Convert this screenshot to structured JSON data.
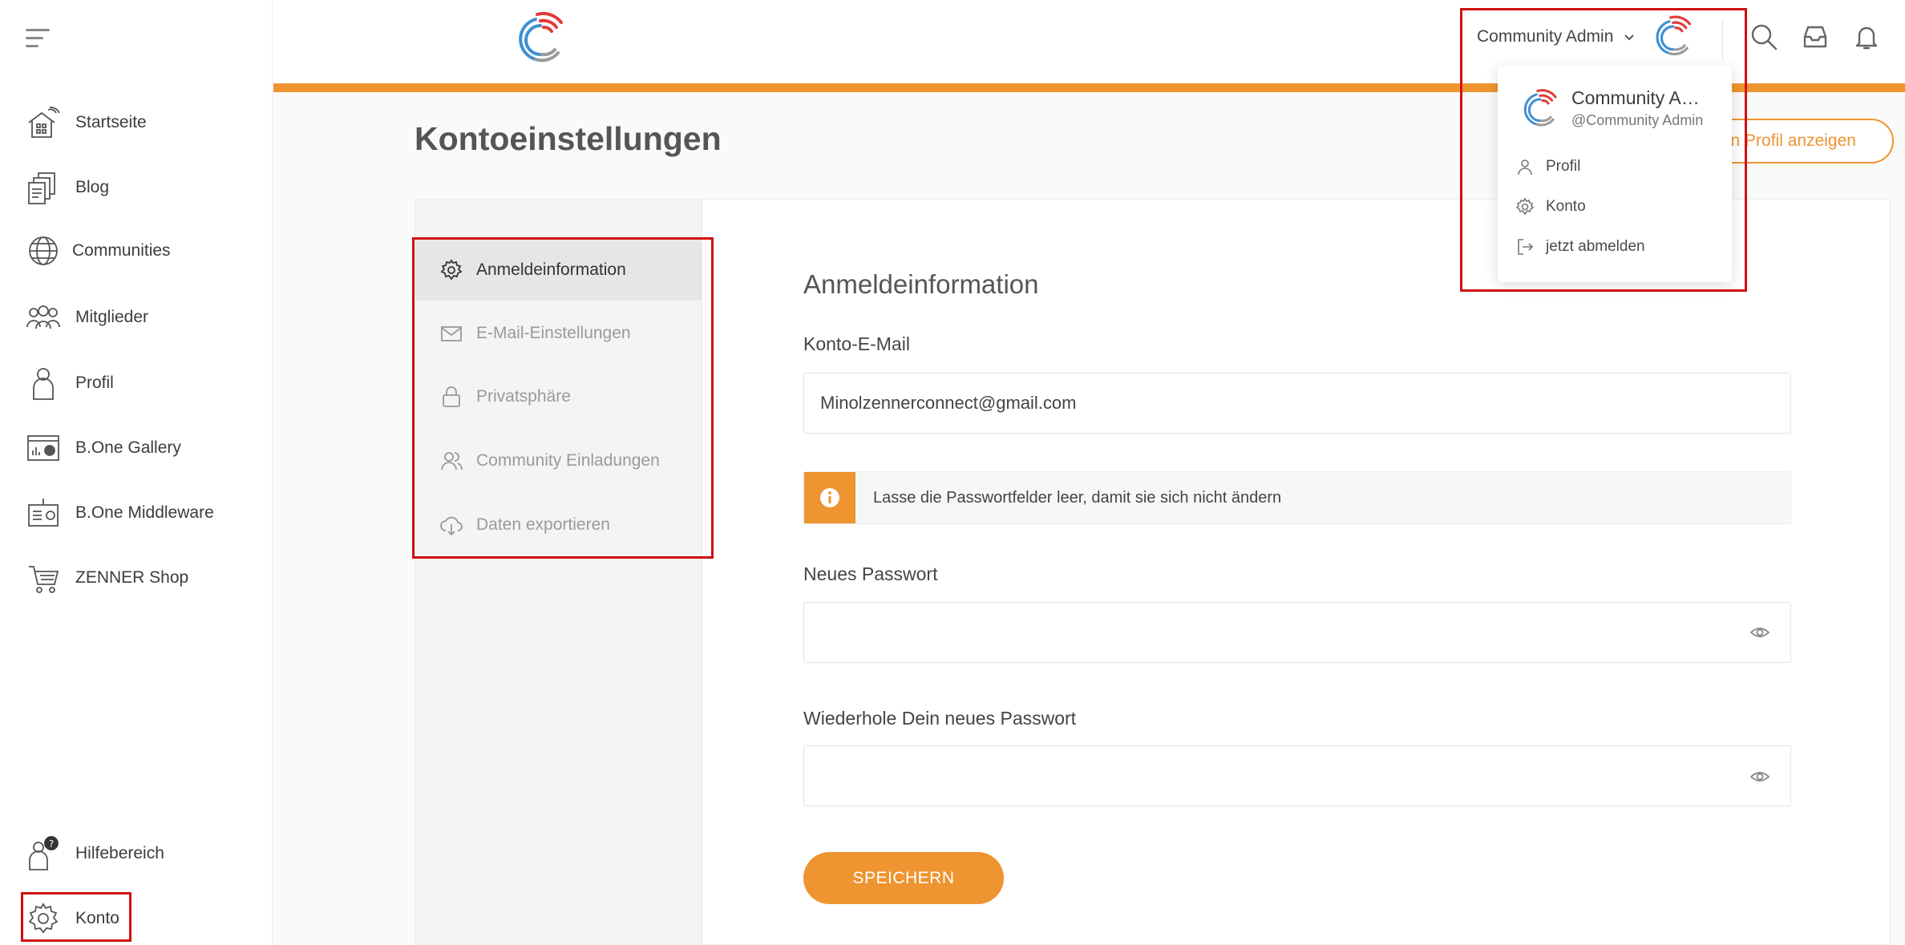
{
  "sidebar": {
    "items": [
      {
        "label": "Startseite",
        "icon": "smart-home-icon"
      },
      {
        "label": "Blog",
        "icon": "documents-icon"
      },
      {
        "label": "Communities",
        "icon": "globe-icon"
      },
      {
        "label": "Mitglieder",
        "icon": "group-icon"
      },
      {
        "label": "Profil",
        "icon": "person-icon"
      },
      {
        "label": "B.One Gallery",
        "icon": "gallery-dashboard-icon"
      },
      {
        "label": "B.One Middleware",
        "icon": "gateway-device-icon"
      },
      {
        "label": "ZENNER Shop",
        "icon": "shopping-cart-icon"
      }
    ],
    "bottom_items": [
      {
        "label": "Hilfebereich",
        "icon": "help-person-icon"
      },
      {
        "label": "Konto",
        "icon": "gear-icon"
      }
    ]
  },
  "header": {
    "user_name": "Community Admin",
    "icons": [
      "search-icon",
      "inbox-icon",
      "bell-icon"
    ]
  },
  "dropdown": {
    "name": "Community Admin",
    "handle": "@Community Admin",
    "items": [
      {
        "label": "Profil",
        "icon": "person-icon"
      },
      {
        "label": "Konto",
        "icon": "gear-icon"
      },
      {
        "label": "jetzt abmelden",
        "icon": "logout-icon"
      }
    ]
  },
  "page": {
    "title": "Kontoeinstellungen",
    "profile_button": "Dein Profil anzeigen"
  },
  "settings_nav": {
    "items": [
      {
        "label": "Anmeldeinformation",
        "icon": "gear-icon",
        "active": true
      },
      {
        "label": "E-Mail-Einstellungen",
        "icon": "mail-icon"
      },
      {
        "label": "Privatsphäre",
        "icon": "lock-icon"
      },
      {
        "label": "Community Einladungen",
        "icon": "users-icon"
      },
      {
        "label": "Daten exportieren",
        "icon": "cloud-download-icon"
      }
    ]
  },
  "form": {
    "section_title": "Anmeldeinformation",
    "email_label": "Konto-E-Mail",
    "email_value": "Minolzennerconnect@gmail.com",
    "info_text": "Lasse die Passwortfelder leer, damit sie sich nicht ändern",
    "new_password_label": "Neues Passwort",
    "repeat_password_label": "Wiederhole Dein neues Passwort",
    "save_label": "SPEICHERN"
  },
  "colors": {
    "accent": "#ee9430",
    "highlight": "#d01010"
  }
}
